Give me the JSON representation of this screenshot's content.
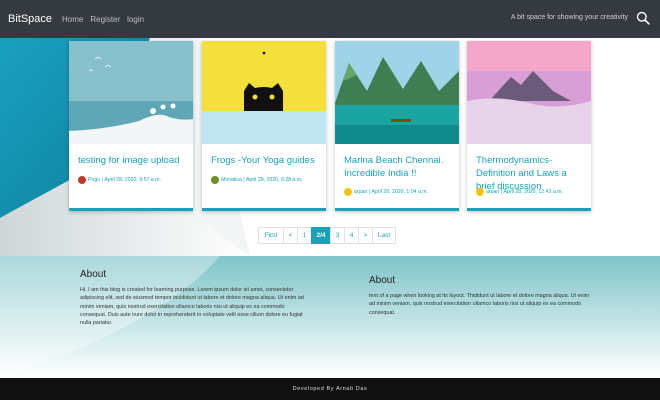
{
  "navbar": {
    "brand": "BitSpace",
    "links": [
      "Home",
      "Register",
      "login"
    ],
    "tagline": "A bit space for showing your creativity",
    "search_icon": "search-icon"
  },
  "posts": [
    {
      "title": "testing for image upload",
      "author": "Pogo",
      "date": "April 28, 2020, 9:57 a.m.",
      "avatar_color": "#c0392b"
    },
    {
      "title": "Frogs -Your Yoga guides",
      "author": "Monalisa",
      "date": "April 28, 2020, 9:28 a.m.",
      "avatar_color": "#6b8e23"
    },
    {
      "title": "Marina Beach Chennai. Incredible India !!",
      "author": "arpan",
      "date": "April 28, 2020, 1:04 a.m.",
      "avatar_color": "#f1c40f"
    },
    {
      "title": "Thermodynamics-Definition and Laws a brief discussion",
      "author": "arpan",
      "date": "April 28, 2020, 12:43 a.m.",
      "avatar_color": "#f1c40f"
    }
  ],
  "pagination": {
    "first": "First",
    "prev": "<",
    "p1": "1",
    "current": "2/4",
    "p3": "3",
    "p4": "4",
    "next": ">",
    "last": "Last"
  },
  "about_left": {
    "heading": "About",
    "text": "Hi, I am this blog is created for learning purpose. Lorem ipsum dolor sit amet, consectetur adipiscing elit, sed do eiusmod tempor incididunt ut labore et dolore magna aliqua. Ut enim ad minim veniam, quis nostrud exercitation ullamco laboris nisi ut aliquip ex ea commodo consequat. Duis aute irure dolor in reprehenderit in voluptate velit esse cillum dolore eu fugiat nulla pariatur."
  },
  "about_right": {
    "heading": "About",
    "text": "tent of a page when looking at its layout. Thididunt ut labore et dolore magna aliqua. Ut enim ad minim veniam, quis nostrud exercitation ullamco laboris nisi ut aliquip ex ea commodo consequat."
  },
  "footer": {
    "text": "Developed By Arnab Das"
  },
  "colors": {
    "accent": "#17a2b8",
    "navbar": "#343a40",
    "footer": "#111111"
  }
}
